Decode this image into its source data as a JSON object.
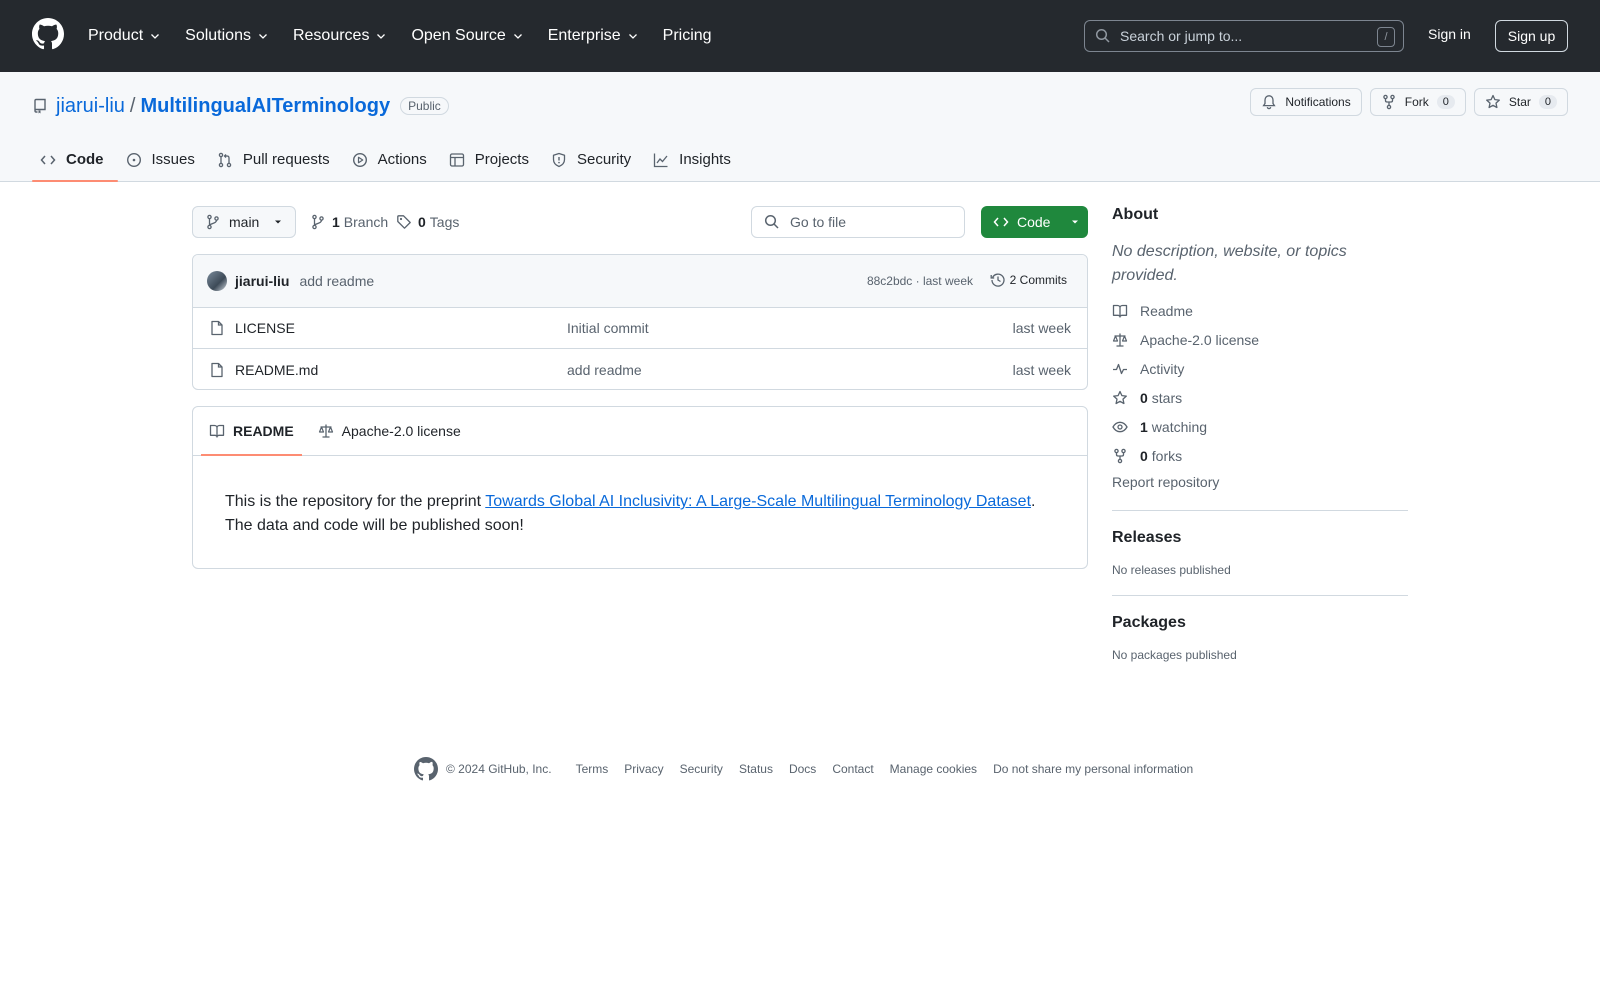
{
  "header": {
    "nav": [
      {
        "label": "Product",
        "has_menu": true
      },
      {
        "label": "Solutions",
        "has_menu": true
      },
      {
        "label": "Resources",
        "has_menu": true
      },
      {
        "label": "Open Source",
        "has_menu": true
      },
      {
        "label": "Enterprise",
        "has_menu": true
      },
      {
        "label": "Pricing",
        "has_menu": false
      }
    ],
    "search_placeholder": "Search or jump to...",
    "search_shortcut": "/",
    "signin_label": "Sign in",
    "signup_label": "Sign up"
  },
  "repo": {
    "owner": "jiarui-liu",
    "separator": "/",
    "name": "MultilingualAITerminology",
    "visibility": "Public",
    "notifications_label": "Notifications",
    "fork_label": "Fork",
    "fork_count": "0",
    "star_label": "Star",
    "star_count": "0",
    "tabs": [
      {
        "label": "Code",
        "icon": "code-icon",
        "active": true
      },
      {
        "label": "Issues",
        "icon": "issue-icon",
        "active": false
      },
      {
        "label": "Pull requests",
        "icon": "pull-request-icon",
        "active": false
      },
      {
        "label": "Actions",
        "icon": "play-icon",
        "active": false
      },
      {
        "label": "Projects",
        "icon": "table-icon",
        "active": false
      },
      {
        "label": "Security",
        "icon": "shield-icon",
        "active": false
      },
      {
        "label": "Insights",
        "icon": "graph-icon",
        "active": false
      }
    ]
  },
  "toolbar": {
    "branch": "main",
    "branch_count": "1",
    "branch_label": "Branch",
    "tag_count": "0",
    "tag_label": "Tags",
    "goto_placeholder": "Go to file",
    "code_label": "Code"
  },
  "latest_commit": {
    "author": "jiarui-liu",
    "message": "add readme",
    "meta": "88c2bdc · last week",
    "commits_label": "2 Commits"
  },
  "files": [
    {
      "name": "LICENSE",
      "message": "Initial commit",
      "date": "last week"
    },
    {
      "name": "README.md",
      "message": "add readme",
      "date": "last week"
    }
  ],
  "readme": {
    "tabs": [
      {
        "label": "README",
        "icon": "book-icon",
        "active": true
      },
      {
        "label": "Apache-2.0 license",
        "icon": "law-icon",
        "active": false
      }
    ],
    "text_before": "This is the repository for the preprint ",
    "link_text": "Towards Global AI Inclusivity: A Large-Scale Multilingual Terminology Dataset",
    "text_after": ". The data and code will be published soon!"
  },
  "sidebar": {
    "about_title": "About",
    "about_desc": "No description, website, or topics provided.",
    "items": [
      {
        "icon": "book-icon",
        "count": "",
        "label": "Readme"
      },
      {
        "icon": "law-icon",
        "count": "",
        "label": "Apache-2.0 license"
      },
      {
        "icon": "pulse-icon",
        "count": "",
        "label": "Activity"
      },
      {
        "icon": "star-icon",
        "count": "0",
        "label": "stars"
      },
      {
        "icon": "eye-icon",
        "count": "1",
        "label": "watching"
      },
      {
        "icon": "fork-icon",
        "count": "0",
        "label": "forks"
      }
    ],
    "report_label": "Report repository",
    "releases_title": "Releases",
    "releases_text": "No releases published",
    "packages_title": "Packages",
    "packages_text": "No packages published"
  },
  "footer": {
    "copyright": "© 2024 GitHub, Inc.",
    "links": [
      "Terms",
      "Privacy",
      "Security",
      "Status",
      "Docs",
      "Contact",
      "Manage cookies",
      "Do not share my personal information"
    ]
  },
  "colors": {
    "header_bg": "#25292e",
    "link": "#0969da",
    "primary_button": "#1f883d",
    "active_tab_underline": "#fd8c73"
  }
}
